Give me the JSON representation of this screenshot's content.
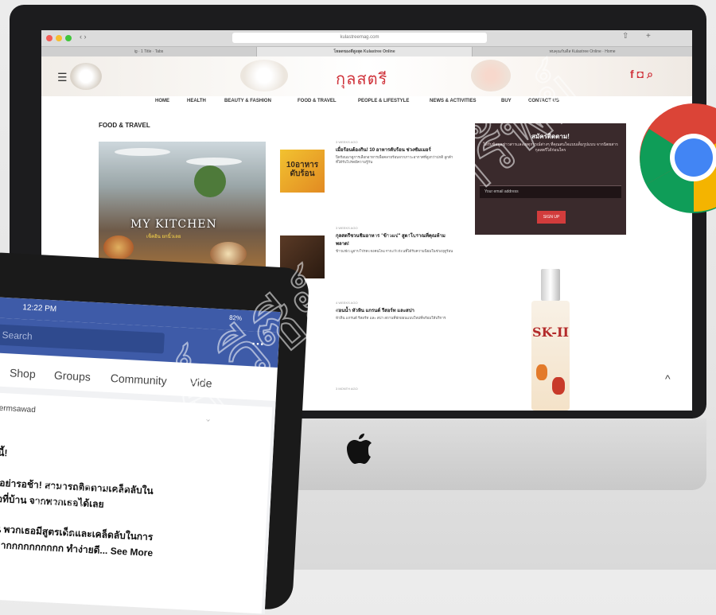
{
  "browser": {
    "url": "kulastreemag.com",
    "tabs": [
      "ig · 1 Title · Tabs",
      "โหลดของดีสูงสุด Kulastree Online",
      "พบคุณกับดีส Kulastree Online · Home"
    ]
  },
  "site": {
    "logo": "กุลสตรี",
    "nav": [
      "HOME",
      "HEALTH",
      "BEAUTY & FASHION",
      "FOOD & TRAVEL",
      "PEOPLE & LIFESTYLE",
      "NEWS & ACTIVITIES",
      "BUY",
      "CONTACT US"
    ],
    "section_title": "FOOD & TRAVEL",
    "featured": {
      "title": "MY KITCHEN",
      "subtitle": "เช็คอิน ยกนิ้วเลย"
    },
    "articles": [
      {
        "thumb_text": "10อาหาร ดับร้อน",
        "date": "3 WEEKS AGO",
        "title": "เมื่อร้อนต้องกิน! 10 อาหารดับร้อน ช่วงซัมเมอร์",
        "excerpt": "ปิดร้อนมาดูการเลือกอาหารเพื่อคลายร้อนจากภาวะอากาศที่สูงกว่าปกติ ลูกค้าที่ได้รับโปรดมีความรู้กัน"
      },
      {
        "date": "3 WEEKS AGO",
        "title": "กุลสตรีชวนชิมอาหาร \"ข้าวแช่\" สูตรโบราณที่คุณห้ามพลาด!",
        "excerpt": "ข้าวแช่เมนูจานโปรดของคนไทยจากสมัยก่อนที่ได้รับความนิยมในช่วงฤดูร้อน"
      },
      {
        "date": "4 WEEKS AGO",
        "title": "สอนน้ำ หัวหิน แกรนด์ รีสอร์ท และสปา",
        "excerpt": "หัวหิน แกรนด์ รีสอร์ท และ สปา สถานที่พักผ่อนแบบใหม่ที่พร้อมให้บริการ"
      },
      {
        "date": "3 MONTH AGO"
      }
    ],
    "newsletter": {
      "title": "สมัครติดตาม!",
      "description": "ได้รับข้อมูลข่าวสารและเหตุการณ์ต่างๆ ที่คุณสนใจแบบเต็มรูปแบบ จากนิตยสารกุลสตรีได้ก่อนใคร",
      "email_placeholder": "Your email address",
      "button": "SIGN UP"
    },
    "product": "SK-II"
  },
  "tablet": {
    "time": "12:22 PM",
    "battery": "82%",
    "search_placeholder": "Search",
    "tabs": [
      "s",
      "Shop",
      "Groups",
      "Community",
      "Vide"
    ],
    "post_author": "sermsawad",
    "post_lines": [
      "ะนี้!",
      "อ อย่ารอช้า! สามารถติดตามเคล็ดลับใน",
      "ชื่อที่บ้าน จากพวกเธอได้เลย",
      "กัน พวกเธอมีสูตรเด็ดและเคล็ดลับในการ",
      "นมากกกกกกกกกก ทำง่ายดี... See More"
    ]
  },
  "watermark": "ลิขสิทธิ์ วีซีย์ อุดมทรัพย์"
}
